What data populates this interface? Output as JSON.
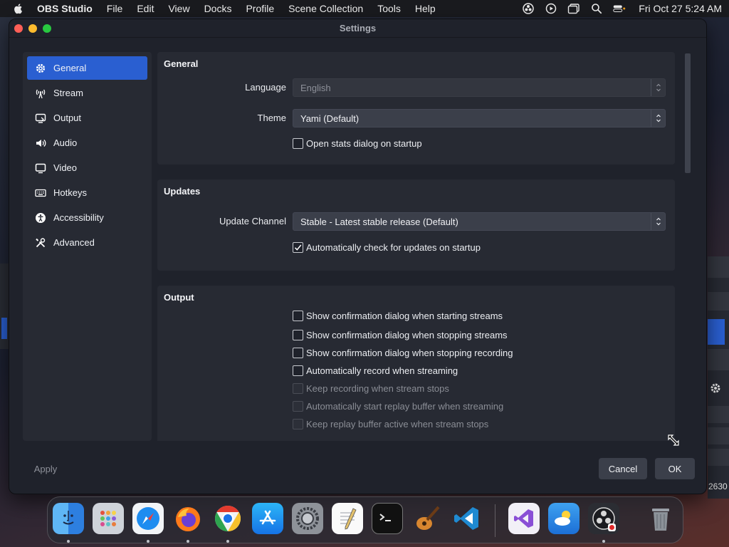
{
  "menubar": {
    "app_name": "OBS Studio",
    "items": [
      "File",
      "Edit",
      "View",
      "Docks",
      "Profile",
      "Scene Collection",
      "Tools",
      "Help"
    ],
    "clock": "Fri Oct 27  5:24 AM",
    "status_icons": [
      "obs-tray-icon",
      "play-circle-icon",
      "windows-icon",
      "search-icon",
      "control-center-icon"
    ]
  },
  "window": {
    "title": "Settings"
  },
  "sidebar": {
    "items": [
      {
        "label": "General",
        "icon": "gear-icon",
        "active": true
      },
      {
        "label": "Stream",
        "icon": "antenna-icon",
        "active": false
      },
      {
        "label": "Output",
        "icon": "output-icon",
        "active": false
      },
      {
        "label": "Audio",
        "icon": "speaker-icon",
        "active": false
      },
      {
        "label": "Video",
        "icon": "monitor-icon",
        "active": false
      },
      {
        "label": "Hotkeys",
        "icon": "keyboard-icon",
        "active": false
      },
      {
        "label": "Accessibility",
        "icon": "accessibility-icon",
        "active": false
      },
      {
        "label": "Advanced",
        "icon": "tools-icon",
        "active": false
      }
    ]
  },
  "general": {
    "title": "General",
    "language_label": "Language",
    "language_value": "English",
    "theme_label": "Theme",
    "theme_value": "Yami (Default)",
    "open_stats_label": "Open stats dialog on startup",
    "open_stats_checked": false
  },
  "updates": {
    "title": "Updates",
    "channel_label": "Update Channel",
    "channel_value": "Stable - Latest stable release (Default)",
    "auto_check_label": "Automatically check for updates on startup",
    "auto_check_checked": true
  },
  "output": {
    "title": "Output",
    "options": [
      {
        "label": "Show confirmation dialog when starting streams",
        "checked": false,
        "enabled": true
      },
      {
        "label": "Show confirmation dialog when stopping streams",
        "checked": false,
        "enabled": true
      },
      {
        "label": "Show confirmation dialog when stopping recording",
        "checked": false,
        "enabled": true
      },
      {
        "label": "Automatically record when streaming",
        "checked": false,
        "enabled": true
      },
      {
        "label": "Keep recording when stream stops",
        "checked": false,
        "enabled": false
      },
      {
        "label": "Automatically start replay buffer when streaming",
        "checked": false,
        "enabled": false
      },
      {
        "label": "Keep replay buffer active when stream stops",
        "checked": false,
        "enabled": false
      }
    ]
  },
  "buttons": {
    "apply": "Apply",
    "cancel": "Cancel",
    "ok": "OK"
  },
  "background": {
    "right_peek_number": "2630"
  },
  "dock": {
    "apps": [
      "finder-icon",
      "launchpad-icon",
      "safari-icon",
      "firefox-icon",
      "chrome-icon",
      "app-store-icon",
      "system-settings-icon",
      "textedit-icon",
      "terminal-icon",
      "garageband-icon",
      "vscode-icon",
      "visual-studio-icon",
      "weather-icon",
      "obs-icon",
      "trash-icon"
    ]
  },
  "colors": {
    "accent": "#2a5fd1",
    "window_bg": "#1f222b",
    "panel_bg": "#272a33",
    "control_bg": "#3b3f4a"
  }
}
